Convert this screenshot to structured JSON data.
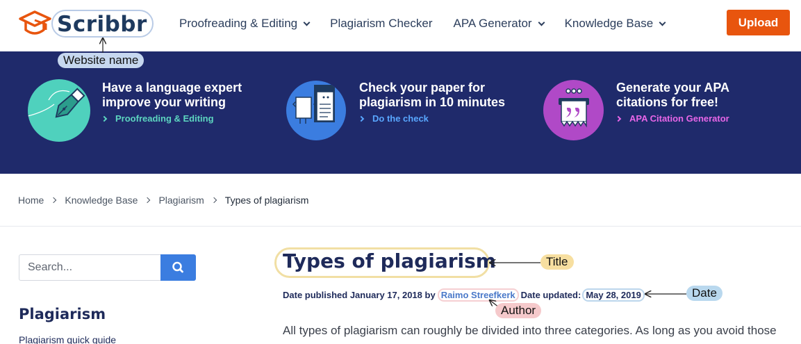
{
  "header": {
    "logo_text": "Scribbr",
    "nav": [
      {
        "label": "Proofreading & Editing",
        "has_dropdown": true
      },
      {
        "label": "Plagiarism Checker",
        "has_dropdown": false
      },
      {
        "label": "APA Generator",
        "has_dropdown": true
      },
      {
        "label": "Knowledge Base",
        "has_dropdown": true
      }
    ],
    "upload_label": "Upload"
  },
  "annotations": {
    "website_name": "Website name",
    "title": "Title",
    "author": "Author",
    "date": "Date"
  },
  "banner": {
    "promos": [
      {
        "heading_line1": "Have a language expert",
        "heading_line2": "improve your writing",
        "link": "Proofreading & Editing",
        "link_color": "#5dd6c0",
        "circle_color": "#4fd1bd",
        "icon": "fountain-pen-icon"
      },
      {
        "heading_line1": "Check your paper for",
        "heading_line2": "plagiarism in 10 minutes",
        "link": "Do the check",
        "link_color": "#59a7ff",
        "circle_color": "#3b7de0",
        "icon": "document-compare-icon"
      },
      {
        "heading_line1": "Generate your APA",
        "heading_line2": "citations for free!",
        "link": "APA Citation Generator",
        "link_color": "#e866e8",
        "circle_color": "#b049c7",
        "icon": "quote-document-icon"
      }
    ]
  },
  "breadcrumb": [
    "Home",
    "Knowledge Base",
    "Plagiarism",
    "Types of plagiarism"
  ],
  "sidebar": {
    "search_placeholder": "Search...",
    "title": "Plagiarism",
    "first_link": "Plagiarism quick guide"
  },
  "article": {
    "title": "Types of plagiarism",
    "published_prefix": "Date published",
    "published_date": "January 17, 2018",
    "by": "by",
    "author": "Raimo Streefkerk",
    "updated_prefix": "Date updated:",
    "updated_date": "May 28, 2019",
    "lead": "All types of plagiarism can roughly be divided into three categories. As long as you avoid those"
  },
  "colors": {
    "brand_orange": "#e8550e",
    "banner_navy": "#1f2a6b",
    "search_blue": "#3b7de0"
  }
}
